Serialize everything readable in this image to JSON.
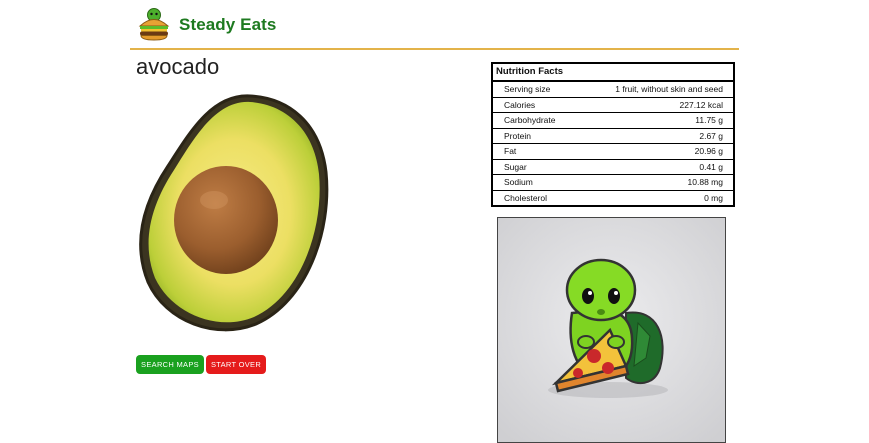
{
  "header": {
    "brand": "Steady Eats",
    "logo_icon": "turtle-burger-logo-icon"
  },
  "food": {
    "name": "avocado",
    "image_icon": "avocado-half-image"
  },
  "buttons": {
    "search_maps": "SEARCH MAPS",
    "start_over": "START OVER"
  },
  "nutrition": {
    "title": "Nutrition Facts",
    "rows": [
      {
        "label": "Serving size",
        "value": "1 fruit, without skin and seed"
      },
      {
        "label": "Calories",
        "value": "227.12 kcal"
      },
      {
        "label": "Carbohydrate",
        "value": "11.75 g"
      },
      {
        "label": "Protein",
        "value": "2.67 g"
      },
      {
        "label": "Fat",
        "value": "20.96 g"
      },
      {
        "label": "Sugar",
        "value": "0.41 g"
      },
      {
        "label": "Sodium",
        "value": "10.88 mg"
      },
      {
        "label": "Cholesterol",
        "value": "0 mg"
      }
    ]
  },
  "side_image": {
    "icon": "turtle-eating-pizza-pin-image"
  },
  "colors": {
    "brand_green": "#1e7a20",
    "rule_gold": "#e3b34a",
    "search_button": "#1aa11f",
    "start_over_button": "#e51b1b"
  }
}
